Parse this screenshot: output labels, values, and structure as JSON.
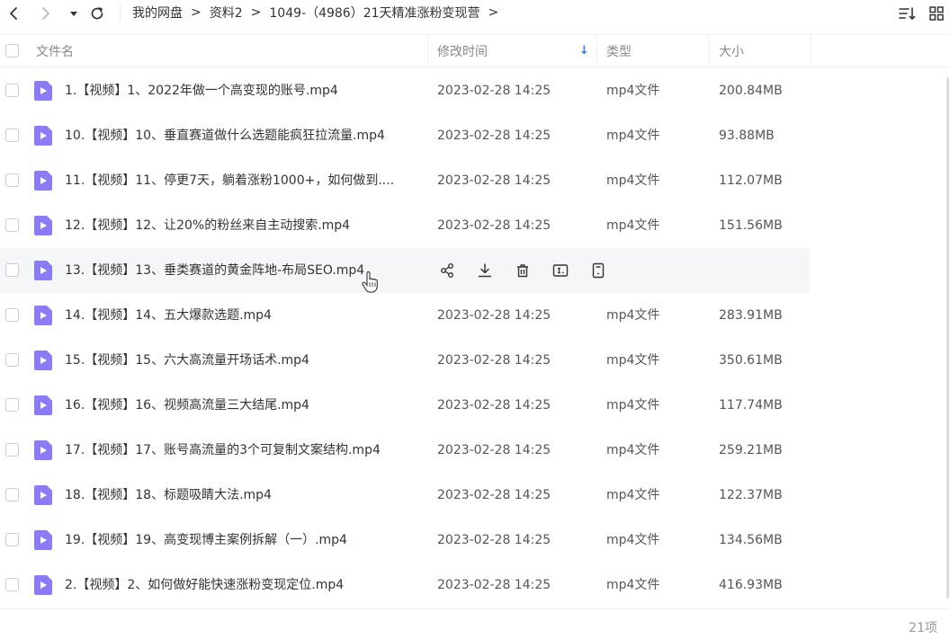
{
  "nav": {
    "breadcrumbs": [
      "我的网盘",
      "资料2",
      "1049-（4986）21天精准涨粉变现营"
    ],
    "separator": ">"
  },
  "table": {
    "columns": {
      "name": "文件名",
      "modified": "修改时间",
      "type": "类型",
      "size": "大小"
    },
    "sort_indicator": "↓",
    "rows": [
      {
        "name": "1.【视频】1、2022年做一个高变现的账号.mp4",
        "date": "2023-02-28 14:25",
        "type": "mp4文件",
        "size": "200.84MB"
      },
      {
        "name": "10.【视频】10、垂直赛道做什么选题能疯狂拉流量.mp4",
        "date": "2023-02-28 14:25",
        "type": "mp4文件",
        "size": "93.88MB"
      },
      {
        "name": "11.【视频】11、停更7天，躺着涨粉1000+，如何做到....",
        "date": "2023-02-28 14:25",
        "type": "mp4文件",
        "size": "112.07MB"
      },
      {
        "name": "12.【视频】12、让20%的粉丝来自主动搜索.mp4",
        "date": "2023-02-28 14:25",
        "type": "mp4文件",
        "size": "151.56MB"
      },
      {
        "name": "13.【视频】13、垂类赛道的黄金阵地-布局SEO.mp4",
        "date": "",
        "type": "",
        "size": "",
        "hovered": true
      },
      {
        "name": "14.【视频】14、五大爆款选题.mp4",
        "date": "2023-02-28 14:25",
        "type": "mp4文件",
        "size": "283.91MB"
      },
      {
        "name": "15.【视频】15、六大高流量开场话术.mp4",
        "date": "2023-02-28 14:25",
        "type": "mp4文件",
        "size": "350.61MB"
      },
      {
        "name": "16.【视频】16、视频高流量三大结尾.mp4",
        "date": "2023-02-28 14:25",
        "type": "mp4文件",
        "size": "117.74MB"
      },
      {
        "name": "17.【视频】17、账号高流量的3个可复制文案结构.mp4",
        "date": "2023-02-28 14:25",
        "type": "mp4文件",
        "size": "259.21MB"
      },
      {
        "name": "18.【视频】18、标题吸睛大法.mp4",
        "date": "2023-02-28 14:25",
        "type": "mp4文件",
        "size": "122.37MB"
      },
      {
        "name": "19.【视频】19、高变现博主案例拆解（一）.mp4",
        "date": "2023-02-28 14:25",
        "type": "mp4文件",
        "size": "134.56MB"
      },
      {
        "name": "2.【视频】2、如何做好能快速涨粉变现定位.mp4",
        "date": "2023-02-28 14:25",
        "type": "mp4文件",
        "size": "416.93MB"
      }
    ],
    "hover_actions": [
      "share-icon",
      "download-icon",
      "delete-icon",
      "rename-icon",
      "more-icon"
    ]
  },
  "footer": {
    "count": "21项"
  },
  "colors": {
    "file_icon": "#8b7cf6",
    "sort_arrow": "#2f7cf6",
    "hover_row": "#f5f6f8"
  }
}
